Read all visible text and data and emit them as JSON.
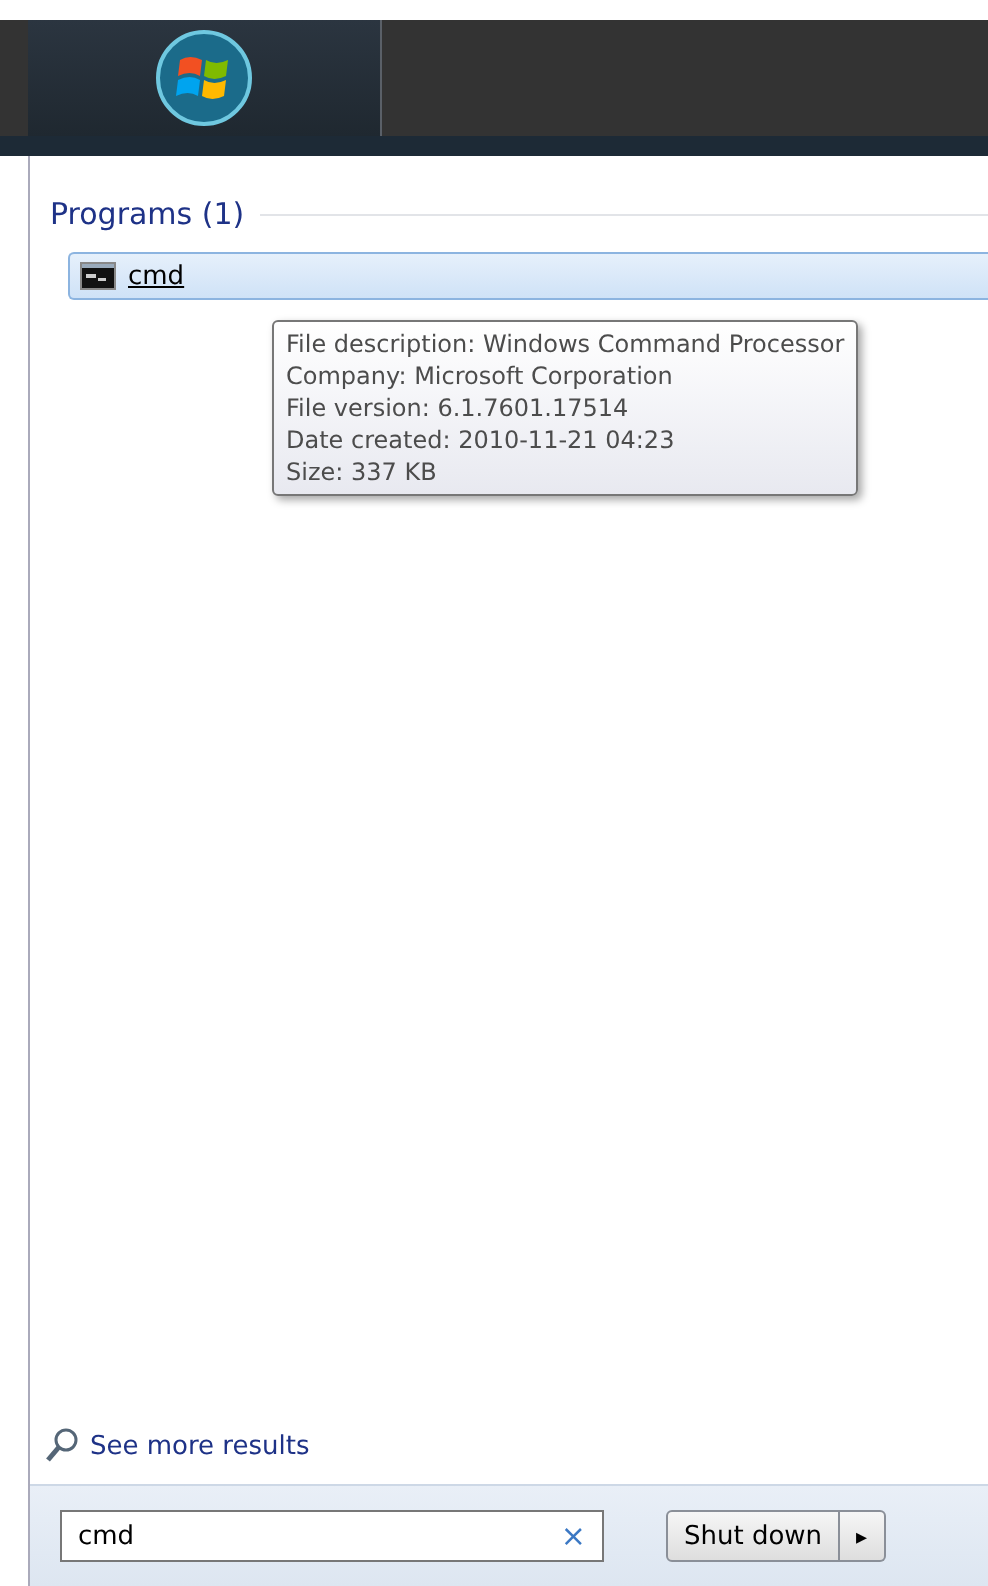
{
  "programs": {
    "heading": "Programs (1)",
    "items": [
      {
        "label": "cmd",
        "selected": true
      }
    ]
  },
  "tooltip": {
    "lines": [
      "File description: Windows Command Processor",
      "Company: Microsoft Corporation",
      "File version: 6.1.7601.17514",
      "Date created: 2010-11-21 04:23",
      "Size: 337 KB"
    ]
  },
  "more_results": "See more results",
  "search": {
    "value": "cmd",
    "clear": "×"
  },
  "shutdown": {
    "label": "Shut down",
    "arrow": "▸"
  }
}
